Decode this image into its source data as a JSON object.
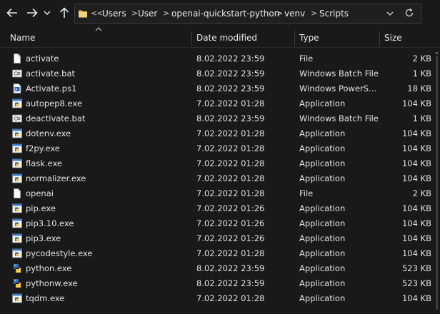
{
  "address": {
    "overflow": "<<",
    "crumbs": [
      "Users",
      "User",
      "openai-quickstart-python",
      "venv",
      "Scripts"
    ],
    "separator": ">"
  },
  "columns": {
    "name": "Name",
    "date": "Date modified",
    "type": "Type",
    "size": "Size"
  },
  "sort": {
    "column": "name",
    "direction": "ascending"
  },
  "files": [
    {
      "name": "activate",
      "date": "8.02.2022 23:59",
      "type": "File",
      "size": "2 KB",
      "icon": "file-icon"
    },
    {
      "name": "activate.bat",
      "date": "8.02.2022 23:59",
      "type": "Windows Batch File",
      "size": "1 KB",
      "icon": "batch-file-icon"
    },
    {
      "name": "Activate.ps1",
      "date": "8.02.2022 23:59",
      "type": "Windows PowerS...",
      "size": "18 KB",
      "icon": "powershell-script-icon"
    },
    {
      "name": "autopep8.exe",
      "date": "7.02.2022 01:28",
      "type": "Application",
      "size": "104 KB",
      "icon": "python-exe-icon"
    },
    {
      "name": "deactivate.bat",
      "date": "8.02.2022 23:59",
      "type": "Windows Batch File",
      "size": "1 KB",
      "icon": "batch-file-icon"
    },
    {
      "name": "dotenv.exe",
      "date": "7.02.2022 01:28",
      "type": "Application",
      "size": "104 KB",
      "icon": "python-exe-icon"
    },
    {
      "name": "f2py.exe",
      "date": "7.02.2022 01:28",
      "type": "Application",
      "size": "104 KB",
      "icon": "python-exe-icon"
    },
    {
      "name": "flask.exe",
      "date": "7.02.2022 01:28",
      "type": "Application",
      "size": "104 KB",
      "icon": "python-exe-icon"
    },
    {
      "name": "normalizer.exe",
      "date": "7.02.2022 01:28",
      "type": "Application",
      "size": "104 KB",
      "icon": "python-exe-icon"
    },
    {
      "name": "openai",
      "date": "7.02.2022 01:28",
      "type": "File",
      "size": "2 KB",
      "icon": "file-icon"
    },
    {
      "name": "pip.exe",
      "date": "7.02.2022 01:26",
      "type": "Application",
      "size": "104 KB",
      "icon": "python-exe-icon"
    },
    {
      "name": "pip3.10.exe",
      "date": "7.02.2022 01:26",
      "type": "Application",
      "size": "104 KB",
      "icon": "python-exe-icon"
    },
    {
      "name": "pip3.exe",
      "date": "7.02.2022 01:26",
      "type": "Application",
      "size": "104 KB",
      "icon": "python-exe-icon"
    },
    {
      "name": "pycodestyle.exe",
      "date": "7.02.2022 01:28",
      "type": "Application",
      "size": "104 KB",
      "icon": "python-exe-icon"
    },
    {
      "name": "python.exe",
      "date": "8.02.2022 23:59",
      "type": "Application",
      "size": "523 KB",
      "icon": "python-logo-icon"
    },
    {
      "name": "pythonw.exe",
      "date": "8.02.2022 23:59",
      "type": "Application",
      "size": "523 KB",
      "icon": "python-logo-icon"
    },
    {
      "name": "tqdm.exe",
      "date": "7.02.2022 01:28",
      "type": "Application",
      "size": "104 KB",
      "icon": "python-exe-icon"
    }
  ],
  "colors": {
    "background": "#191919",
    "text": "#e3e3e3",
    "folder": "#e8c15a"
  }
}
